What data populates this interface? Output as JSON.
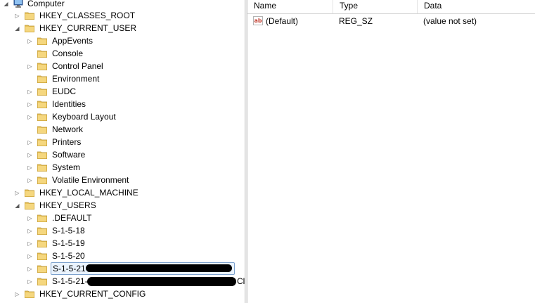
{
  "tree": {
    "root": "Computer",
    "nodes": [
      {
        "label": "HKEY_CLASSES_ROOT",
        "expander": "right"
      },
      {
        "label": "HKEY_CURRENT_USER",
        "expander": "down"
      },
      {
        "label": "AppEvents",
        "expander": "right"
      },
      {
        "label": "Console",
        "expander": "none"
      },
      {
        "label": "Control Panel",
        "expander": "right"
      },
      {
        "label": "Environment",
        "expander": "none"
      },
      {
        "label": "EUDC",
        "expander": "right"
      },
      {
        "label": "Identities",
        "expander": "right"
      },
      {
        "label": "Keyboard Layout",
        "expander": "right"
      },
      {
        "label": "Network",
        "expander": "none"
      },
      {
        "label": "Printers",
        "expander": "right"
      },
      {
        "label": "Software",
        "expander": "right"
      },
      {
        "label": "System",
        "expander": "right"
      },
      {
        "label": "Volatile Environment",
        "expander": "right"
      },
      {
        "label": "HKEY_LOCAL_MACHINE",
        "expander": "right"
      },
      {
        "label": "HKEY_USERS",
        "expander": "down"
      },
      {
        "label": ".DEFAULT",
        "expander": "right"
      },
      {
        "label": "S-1-5-18",
        "expander": "right"
      },
      {
        "label": "S-1-5-19",
        "expander": "right"
      },
      {
        "label": "S-1-5-20",
        "expander": "right"
      },
      {
        "label": "S-1-5-21-",
        "expander": "right"
      },
      {
        "label": "S-1-5-21-",
        "expander": "right"
      },
      {
        "label": "HKEY_CURRENT_CONFIG",
        "expander": "right"
      }
    ],
    "redacted_suffix_2": "Cl"
  },
  "list": {
    "columns": {
      "name": "Name",
      "type": "Type",
      "data": "Data"
    },
    "rows": [
      {
        "icon": "string-value-icon",
        "icon_text": "ab",
        "name": "(Default)",
        "type": "REG_SZ",
        "data": "(value not set)"
      }
    ]
  },
  "colors": {
    "folder": "#e8c25a",
    "selection_border": "#7da2ce",
    "selection_fill": "#eaf3fd"
  }
}
